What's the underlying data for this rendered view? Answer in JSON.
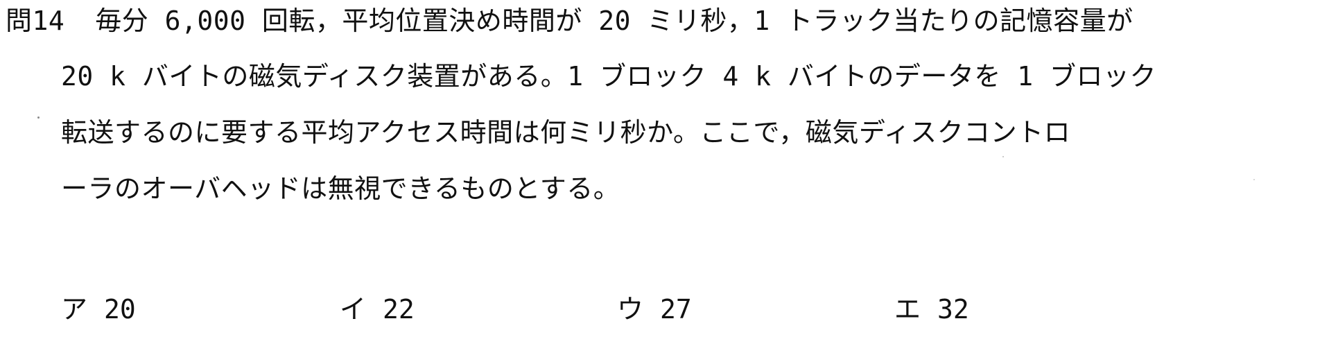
{
  "question": {
    "number": "問14",
    "lines": [
      "毎分 6,000 回転，平均位置決め時間が 20 ミリ秒，1 トラック当たりの記憶容量が",
      "20 k バイトの磁気ディスク装置がある。1 ブロック 4 k バイトのデータを 1 ブロック",
      "転送するのに要する平均アクセス時間は何ミリ秒か。ここで，磁気ディスクコントロ",
      "ーラのオーバヘッドは無視できるものとする。"
    ]
  },
  "choices": [
    {
      "label": "ア",
      "value": "20"
    },
    {
      "label": "イ",
      "value": "22"
    },
    {
      "label": "ウ",
      "value": "27"
    },
    {
      "label": "エ",
      "value": "32"
    }
  ]
}
